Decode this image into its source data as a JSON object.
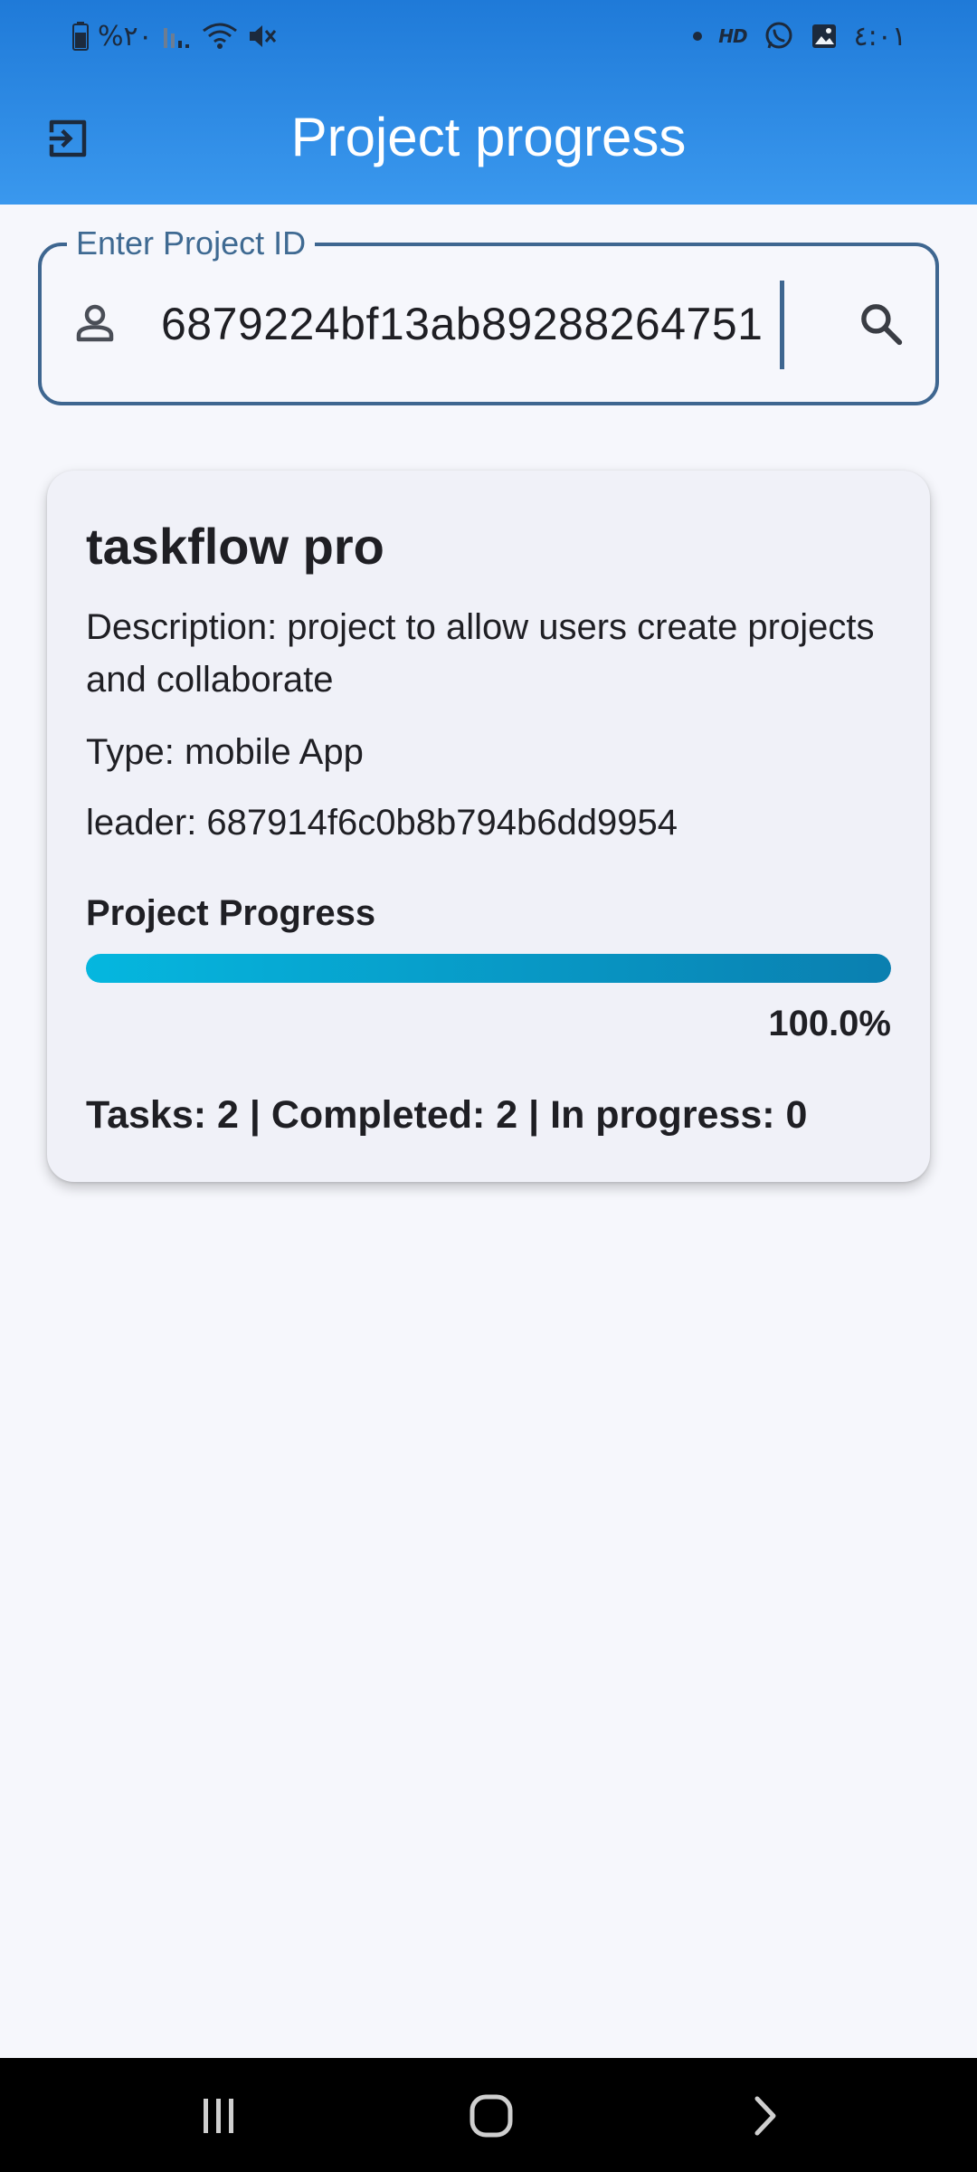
{
  "status_bar": {
    "battery_percent": "%٢٠",
    "time": "٤:٠١",
    "hd_badge": "HD",
    "icons_left": [
      "battery-icon",
      "signal-icon",
      "wifi-icon",
      "mute-icon"
    ],
    "icons_right": [
      "notification-dot-icon",
      "hd-voice-icon",
      "whatsapp-icon",
      "gallery-icon"
    ]
  },
  "header": {
    "title": "Project progress",
    "logout_icon": "logout-icon"
  },
  "search": {
    "label": "Enter Project ID",
    "value": "6879224bf13ab89288264751",
    "leading_icon": "person-icon",
    "trailing_icon": "search-icon"
  },
  "project": {
    "name": "taskflow pro",
    "description": "Description: project to allow users create projects and collaborate",
    "type": "Type: mobile App",
    "leader": "leader: 687914f6c0b8b794b6dd9954",
    "progress_heading": "Project Progress",
    "progress_fraction": 1.0,
    "progress_label": "100.0%",
    "task_summary": "Tasks: 2 | Completed: 2 | In progress: 0"
  },
  "nav": {
    "recents_icon": "recents-icon",
    "home_icon": "home-icon",
    "back_icon": "back-icon"
  },
  "colors": {
    "appbar_top": "#1f7ad8",
    "appbar_bottom": "#3a98ee",
    "field_border": "#3e6690",
    "progress_start": "#05b7df",
    "progress_end": "#0a7fb0",
    "background": "#f6f7fc",
    "card": "#f0f1f8"
  }
}
